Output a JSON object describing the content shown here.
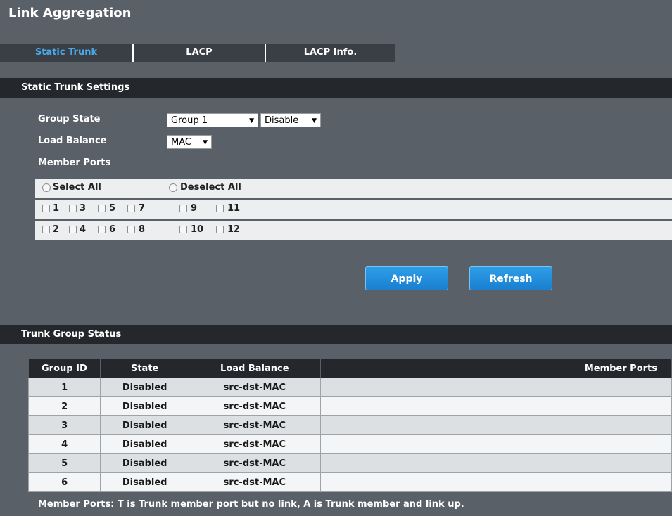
{
  "page": {
    "title": "Link Aggregation"
  },
  "tabs": [
    {
      "label": "Static Trunk",
      "active": true
    },
    {
      "label": "LACP",
      "active": false
    },
    {
      "label": "LACP Info.",
      "active": false
    }
  ],
  "settings": {
    "section_title": "Static Trunk Settings",
    "group_state_label": "Group State",
    "group_value": "Group 1",
    "state_value": "Disable",
    "load_balance_label": "Load Balance",
    "load_balance_value": "MAC",
    "member_ports_label": "Member Ports",
    "select_all": "Select All",
    "deselect_all": "Deselect All",
    "odd_ports": [
      "1",
      "3",
      "5",
      "7",
      "9",
      "11"
    ],
    "even_ports": [
      "2",
      "4",
      "6",
      "8",
      "10",
      "12"
    ]
  },
  "buttons": {
    "apply": "Apply",
    "refresh": "Refresh"
  },
  "status": {
    "section_title": "Trunk Group Status",
    "columns": [
      "Group ID",
      "State",
      "Load Balance",
      "Member Ports"
    ],
    "rows": [
      [
        "1",
        "Disabled",
        "src-dst-MAC",
        ""
      ],
      [
        "2",
        "Disabled",
        "src-dst-MAC",
        ""
      ],
      [
        "3",
        "Disabled",
        "src-dst-MAC",
        ""
      ],
      [
        "4",
        "Disabled",
        "src-dst-MAC",
        ""
      ],
      [
        "5",
        "Disabled",
        "src-dst-MAC",
        ""
      ],
      [
        "6",
        "Disabled",
        "src-dst-MAC",
        ""
      ]
    ],
    "footnote": "Member Ports: T is Trunk member port but no link, A is Trunk member and link up."
  },
  "colors": {
    "background": "#5a6068",
    "header_bar": "#24272b",
    "active_tab": "#4aa8e8",
    "button": "#1a7fd0"
  }
}
